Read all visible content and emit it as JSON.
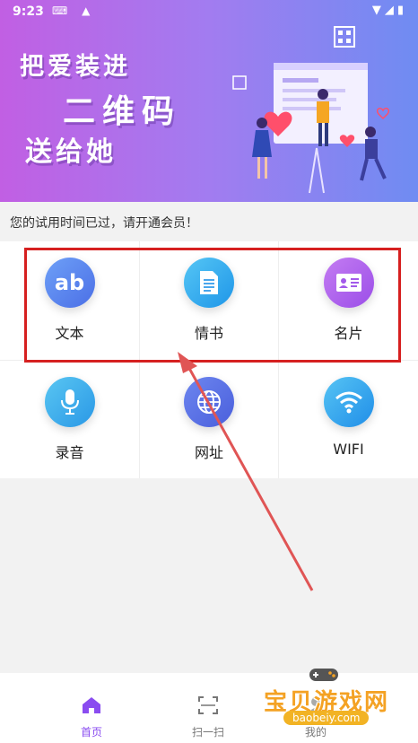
{
  "status_bar": {
    "time": "9:23"
  },
  "banner": {
    "line1": "把爱装进",
    "line2": "二维码",
    "line3": "送给她"
  },
  "notice": "您的试用时间已过，请开通会员！",
  "grid": [
    {
      "label": "文本",
      "icon": "ab-text-icon",
      "color_from": "#6ea0f7",
      "color_to": "#4b6fe6",
      "glyph": "ab"
    },
    {
      "label": "情书",
      "icon": "document-icon",
      "color_from": "#55c6f5",
      "color_to": "#1f96e8"
    },
    {
      "label": "名片",
      "icon": "card-icon",
      "color_from": "#c47cf2",
      "color_to": "#9b4ee8"
    },
    {
      "label": "录音",
      "icon": "microphone-icon",
      "color_from": "#59c6f2",
      "color_to": "#2a98e6"
    },
    {
      "label": "网址",
      "icon": "globe-icon",
      "color_from": "#6d86ef",
      "color_to": "#4a5fdc"
    },
    {
      "label": "WIFI",
      "icon": "wifi-icon",
      "color_from": "#56c4f4",
      "color_to": "#208ee8"
    }
  ],
  "nav": {
    "home": "首页",
    "scan": "扫一扫",
    "mine": "我的"
  },
  "watermark": {
    "title": "宝贝游戏网",
    "url": "baobeiy.com"
  },
  "colors": {
    "accent": "#8a4cf0",
    "highlight": "#d62020",
    "arrow": "#e05555"
  }
}
